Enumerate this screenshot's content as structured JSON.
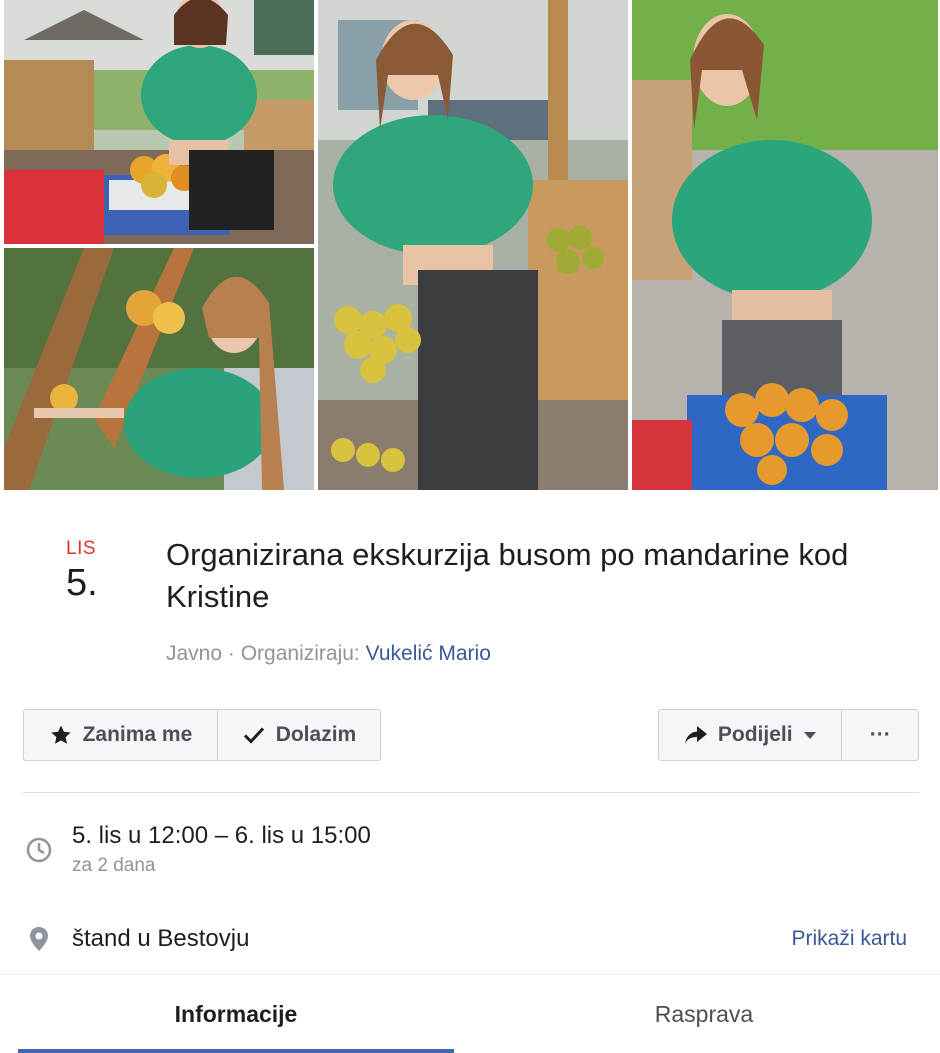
{
  "event": {
    "date_month": "LIS",
    "date_day": "5.",
    "title": "Organizirana ekskurzija busom po mandarine kod Kristine",
    "privacy": "Javno",
    "organizer_prefix": "Organiziraju:",
    "organizer_name": "Vukelić Mario"
  },
  "actions": {
    "interested_label": "Zanima me",
    "going_label": "Dolazim",
    "share_label": "Podijeli",
    "more_label": "···"
  },
  "details": {
    "time_range": "5. lis u 12:00 – 6. lis u 15:00",
    "time_relative": "za 2 dana",
    "location": "štand u Bestovju",
    "map_link": "Prikaži kartu"
  },
  "tabs": {
    "info": "Informacije",
    "discussion": "Rasprava"
  },
  "colors": {
    "accent": "#4267b2",
    "link": "#385898",
    "date_red": "#e4312a"
  }
}
